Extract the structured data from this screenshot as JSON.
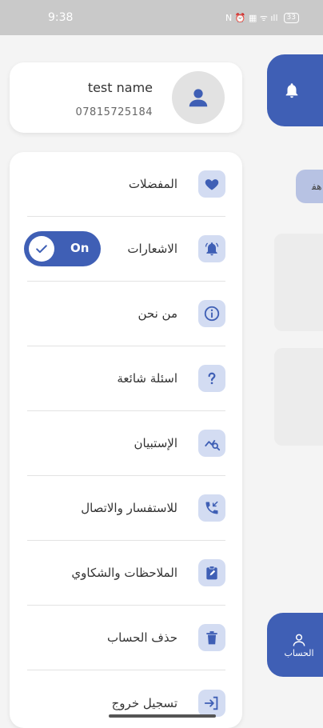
{
  "status_bar": {
    "time": "9:38",
    "icons": "N ⏰ ▦ ᯤ ıll",
    "battery": "33"
  },
  "profile": {
    "name": "test name",
    "phone": "07815725184"
  },
  "menu": {
    "items": [
      {
        "label": "المفضلات",
        "icon": "heart-icon"
      },
      {
        "label": "الاشعارات",
        "icon": "bell-icon",
        "toggle_label": "On",
        "toggle_on": true
      },
      {
        "label": "من نحن",
        "icon": "info-icon"
      },
      {
        "label": "اسئلة شائعة",
        "icon": "question-icon"
      },
      {
        "label": "الإستبيان",
        "icon": "survey-icon"
      },
      {
        "label": "للاستفسار والاتصال",
        "icon": "phone-icon"
      },
      {
        "label": "الملاحظات والشكاوي",
        "icon": "clipboard-icon"
      },
      {
        "label": "حذف الحساب",
        "icon": "trash-icon"
      },
      {
        "label": "تسجيل خروج",
        "icon": "logout-icon"
      }
    ]
  },
  "background": {
    "chip_text": "ﻫﻔ",
    "nav_tab_label": "الحساب"
  },
  "colors": {
    "accent": "#3f5fb5",
    "icon_bg": "#d3dcf2"
  }
}
